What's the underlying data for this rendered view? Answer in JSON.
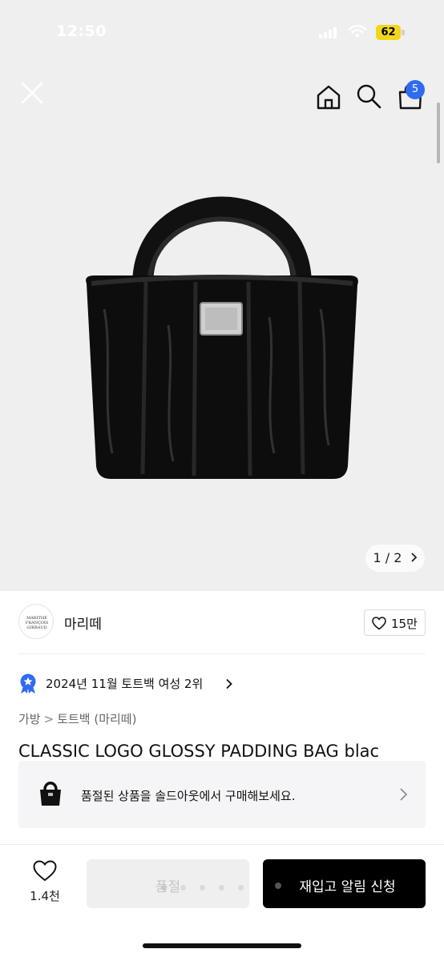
{
  "status_bar": {
    "time": "12:50",
    "battery": "62"
  },
  "header": {
    "cart_badge": "5"
  },
  "gallery": {
    "page_indicator": "1 / 2",
    "current_page": 1,
    "total_pages": 2
  },
  "brand": {
    "name": "마리떼",
    "logo_text": "MARITHÉ FRANÇOIS GIRBAUD",
    "likes": "15만"
  },
  "ranking": {
    "text": "2024년 11월 토트백 여성 2위"
  },
  "breadcrumb": {
    "items": [
      "가방",
      "토트백 (마리떼)"
    ]
  },
  "product": {
    "title": "CLASSIC LOGO GLOSSY PADDING BAG blac"
  },
  "soldout_banner": {
    "text": "품절된 상품을 솔드아웃에서 구매해보세요."
  },
  "bottom_bar": {
    "wish_count": "1.4천",
    "soldout_label": "품절",
    "restock_label": "재입고 알림 신청"
  },
  "colors": {
    "accent": "#2f6bf0",
    "battery": "#f2d61d",
    "primary_button": "#000000",
    "disabled_button": "#efefef"
  },
  "icons": [
    "close-icon",
    "home-icon",
    "search-icon",
    "shopping-bag-icon",
    "heart-icon",
    "medal-icon",
    "chevron-right-icon"
  ]
}
